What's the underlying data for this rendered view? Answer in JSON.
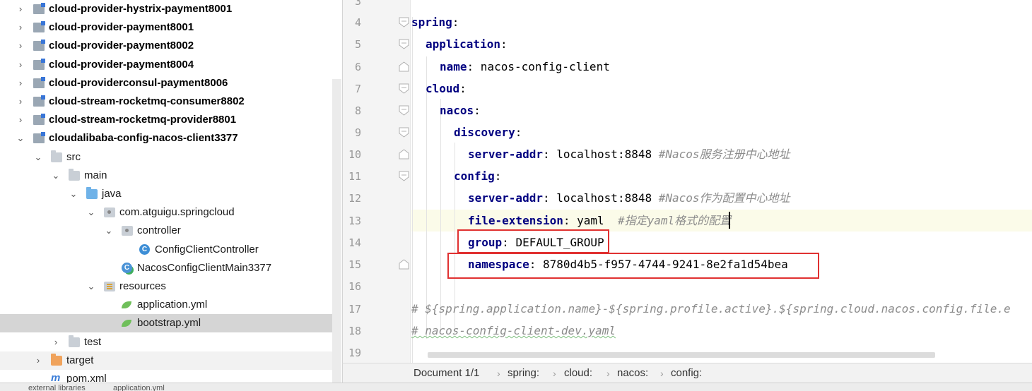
{
  "project_tree": {
    "items": [
      {
        "label": "cloud-provider-hystrix-payment8001",
        "icon": "module-icon",
        "arrow": "›"
      },
      {
        "label": "cloud-provider-payment8001",
        "icon": "module-icon",
        "arrow": "›"
      },
      {
        "label": "cloud-provider-payment8002",
        "icon": "module-icon",
        "arrow": "›"
      },
      {
        "label": "cloud-provider-payment8004",
        "icon": "module-icon",
        "arrow": "›"
      },
      {
        "label": "cloud-providerconsul-payment8006",
        "icon": "module-icon",
        "arrow": "›"
      },
      {
        "label": "cloud-stream-rocketmq-consumer8802",
        "icon": "module-icon",
        "arrow": "›"
      },
      {
        "label": "cloud-stream-rocketmq-provider8801",
        "icon": "module-icon",
        "arrow": "›"
      },
      {
        "label": "cloudalibaba-config-nacos-client3377",
        "icon": "module-icon",
        "arrow": "⌄"
      },
      {
        "label": "src",
        "icon": "folder-icon",
        "arrow": "⌄"
      },
      {
        "label": "main",
        "icon": "folder-icon",
        "arrow": "⌄"
      },
      {
        "label": "java",
        "icon": "source-folder-icon",
        "arrow": "⌄"
      },
      {
        "label": "com.atguigu.springcloud",
        "icon": "package-icon",
        "arrow": "⌄"
      },
      {
        "label": "controller",
        "icon": "package-icon",
        "arrow": "⌄"
      },
      {
        "label": "ConfigClientController",
        "icon": "class-icon"
      },
      {
        "label": "NacosConfigClientMain3377",
        "icon": "spring-boot-class-icon"
      },
      {
        "label": "resources",
        "icon": "resources-folder-icon",
        "arrow": "⌄"
      },
      {
        "label": "application.yml",
        "icon": "yaml-file-icon"
      },
      {
        "label": "bootstrap.yml",
        "icon": "yaml-file-icon"
      },
      {
        "label": "test",
        "icon": "folder-icon",
        "arrow": "›"
      },
      {
        "label": "target",
        "icon": "excluded-folder-icon",
        "arrow": "›"
      },
      {
        "label": "pom.xml",
        "icon": "maven-icon"
      }
    ],
    "selected": "bootstrap.yml"
  },
  "bottom_tabs": [
    "external libraries",
    "application.yml"
  ],
  "editor": {
    "line_numbers": [
      "3",
      "4",
      "5",
      "6",
      "7",
      "8",
      "9",
      "10",
      "11",
      "12",
      "13",
      "14",
      "15",
      "16",
      "17",
      "18",
      "19"
    ],
    "lines": {
      "l4_key": "spring",
      "l5_key": "application",
      "l6_key": "name",
      "l6_val": " nacos-config-client",
      "l7_key": "cloud",
      "l8_key": "nacos",
      "l9_key": "discovery",
      "l10_key": "server-addr",
      "l10_val": " localhost:8848 ",
      "l10_cmt": "#Nacos服务注册中心地址",
      "l11_key": "config",
      "l12_key": "server-addr",
      "l12_val": " localhost:8848 ",
      "l12_cmt": "#Nacos作为配置中心地址",
      "l13_key": "file-extension",
      "l13_val": " yaml  ",
      "l13_cmt": "#指定yaml格式的配置",
      "l14_key": "group",
      "l14_val": " DEFAULT_GROUP",
      "l15_key": "namespace",
      "l15_val": " 8780d4b5-f957-4744-9241-8e2fa1d54bea",
      "l17_cmt": "# ${spring.application.name}-${spring.profile.active}.${spring.cloud.nacos.config.file.e",
      "l18_cmt": "# nacos-config-client-dev.yaml"
    },
    "colon": ":"
  },
  "breadcrumbs": [
    "Document 1/1",
    "spring:",
    "cloud:",
    "nacos:",
    "config:"
  ],
  "breadcrumb_separator": "›",
  "colors": {
    "key": "#000080",
    "comment": "#8c8c8c",
    "highlight_box": "#e03131",
    "selection": "#d5d5d5",
    "caret_line": "#fbfbe9"
  }
}
